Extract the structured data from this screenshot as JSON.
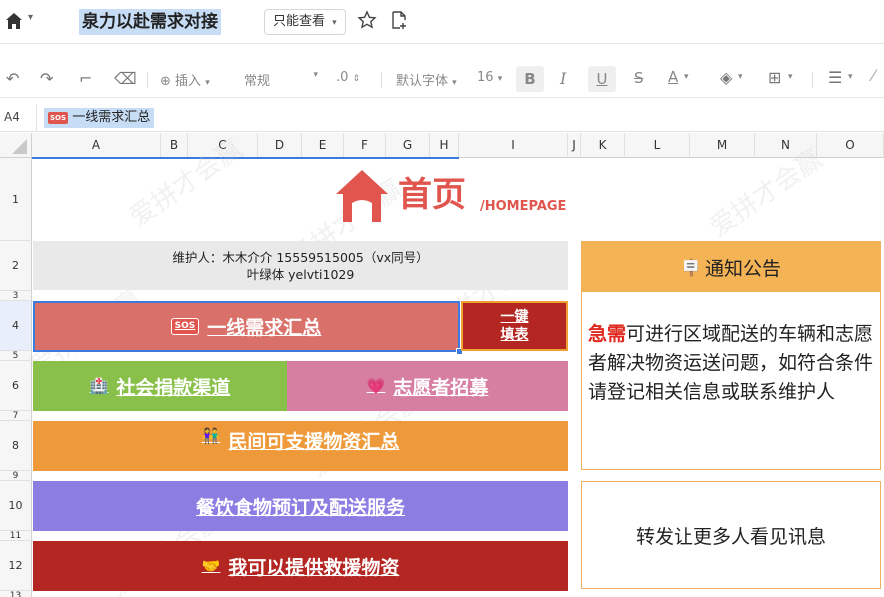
{
  "titlebar": {
    "doc_title": "泉力以赴需求对接",
    "mode_label": "只能查看",
    "mode_caret": "▾",
    "home_caret": "▾"
  },
  "toolbar": {
    "insert_label": "插入",
    "format_label": "常规",
    "decimal_label": ".0",
    "font_label": "默认字体",
    "font_size": "16",
    "caret": "▾"
  },
  "formula_bar": {
    "cell_ref": "A4",
    "sos_badge": "SOS",
    "content": "一线需求汇总"
  },
  "columns": [
    "A",
    "B",
    "C",
    "D",
    "E",
    "F",
    "G",
    "H",
    "I",
    "J",
    "K",
    "L",
    "M",
    "N",
    "O"
  ],
  "rows": [
    "1",
    "2",
    "3",
    "4",
    "5",
    "6",
    "7",
    "8",
    "9",
    "10",
    "11",
    "12",
    "13"
  ],
  "header": {
    "homepage_cn": "首页",
    "homepage_en": "/HOMEPAGE"
  },
  "maintainer": {
    "line1": "维护人：木木介介 15559515005（vx同号）",
    "line2": "叶绿体 yelvti1029"
  },
  "blocks": {
    "frontline_icon": "🆘",
    "frontline": "一线需求汇总",
    "one_click_line1": "一键",
    "one_click_line2": "填表",
    "donation_icon": "🏥",
    "donation": "社会捐款渠道",
    "volunteer_icon": "💗",
    "volunteer": "志愿者招募",
    "civil_icon": "👫",
    "civil": "民间可支援物资汇总",
    "food": "餐饮食物预订及配送服务",
    "provide_icon": "🤝",
    "provide": "我可以提供救援物资"
  },
  "notice": {
    "icon": "🪧",
    "title": "通知公告",
    "urgent": "急需",
    "body": "可进行区域配送的车辆和志愿者解决物资运送问题，如符合条件请登记相关信息或联系维护人"
  },
  "share_box": "转发让更多人看见讯息",
  "watermark": "爱拼才会赢",
  "colors": {
    "red_block": "#d9706a",
    "dark_red": "#b42621",
    "green": "#88c04a",
    "pink": "#d77fa0",
    "orange": "#ee9a3a",
    "purple": "#8b7de2",
    "notice_header": "#f4b354",
    "logo_red": "#e0564e"
  }
}
